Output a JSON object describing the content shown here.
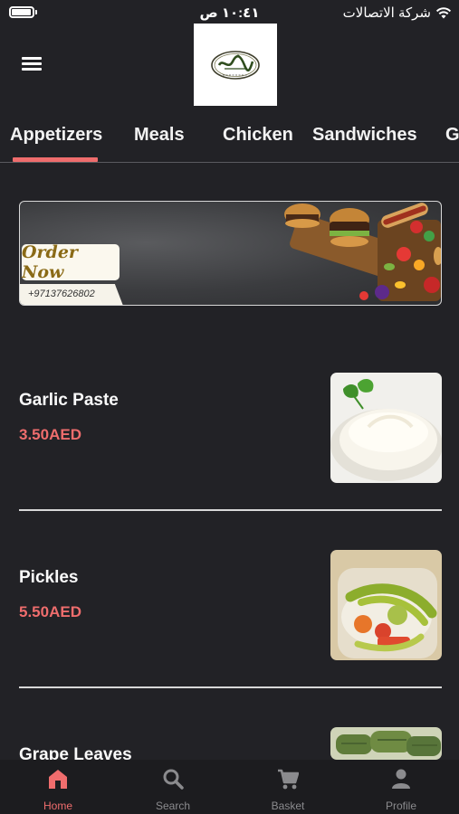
{
  "status_bar": {
    "time": "١٠:٤١ ص",
    "carrier": "شركة الاتصالات"
  },
  "header": {
    "menu_icon": "hamburger-menu-icon",
    "logo_alt": "restaurant-logo"
  },
  "tabs": [
    {
      "label": "Appetizers",
      "active": true
    },
    {
      "label": "Meals",
      "active": false
    },
    {
      "label": "Chicken",
      "active": false
    },
    {
      "label": "Sandwiches",
      "active": false
    },
    {
      "label": "G",
      "active": false
    }
  ],
  "banner": {
    "button_label": "Order Now",
    "phone": "+97137626802"
  },
  "items": [
    {
      "name": "Garlic Paste",
      "price": "3.50AED"
    },
    {
      "name": "Pickles",
      "price": "5.50AED"
    },
    {
      "name": "Grape Leaves",
      "price": ""
    }
  ],
  "bottom_nav": [
    {
      "label": "Home",
      "icon": "home-icon",
      "active": true
    },
    {
      "label": "Search",
      "icon": "search-icon",
      "active": false
    },
    {
      "label": "Basket",
      "icon": "cart-icon",
      "active": false
    },
    {
      "label": "Profile",
      "icon": "person-icon",
      "active": false
    }
  ],
  "colors": {
    "accent": "#ef6d6d",
    "background": "#222226",
    "nav_background": "#1c1c1f"
  }
}
